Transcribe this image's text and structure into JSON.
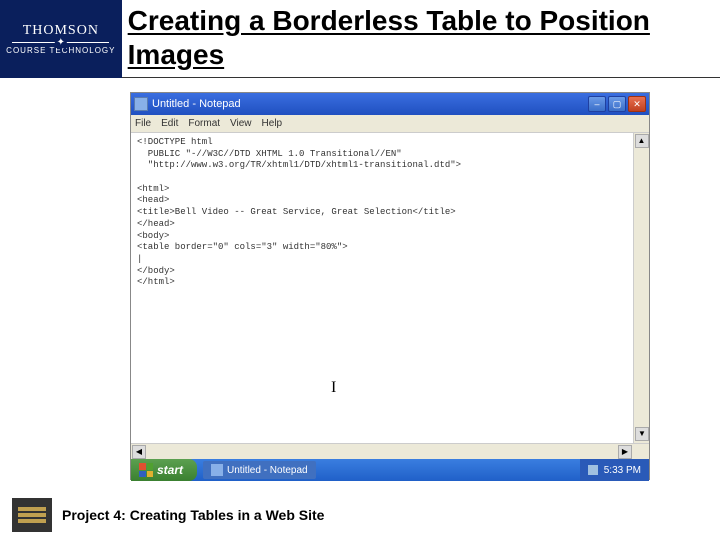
{
  "header": {
    "logo_top": "THOMSON",
    "logo_star": "✦",
    "logo_bottom": "COURSE TECHNOLOGY",
    "title": "Creating a Borderless Table to Position Images"
  },
  "window": {
    "title": "Untitled - Notepad",
    "minimize": "–",
    "maximize": "▢",
    "close": "✕"
  },
  "menu": {
    "file": "File",
    "edit": "Edit",
    "format": "Format",
    "view": "View",
    "help": "Help"
  },
  "editor": {
    "content": "<!DOCTYPE html\n  PUBLIC \"-//W3C//DTD XHTML 1.0 Transitional//EN\"\n  \"http://www.w3.org/TR/xhtml1/DTD/xhtml1-transitional.dtd\">\n\n<html>\n<head>\n<title>Bell Video -- Great Service, Great Selection</title>\n</head>\n<body>\n<table border=\"0\" cols=\"3\" width=\"80%\">\n|\n</body>\n</html>",
    "cursor": "I",
    "up": "▲",
    "down": "▼",
    "left": "◀",
    "right": "▶"
  },
  "taskbar": {
    "start": "start",
    "app": "Untitled - Notepad",
    "time": "5:33 PM"
  },
  "footer": {
    "text": "Project 4: Creating Tables in a Web Site"
  }
}
